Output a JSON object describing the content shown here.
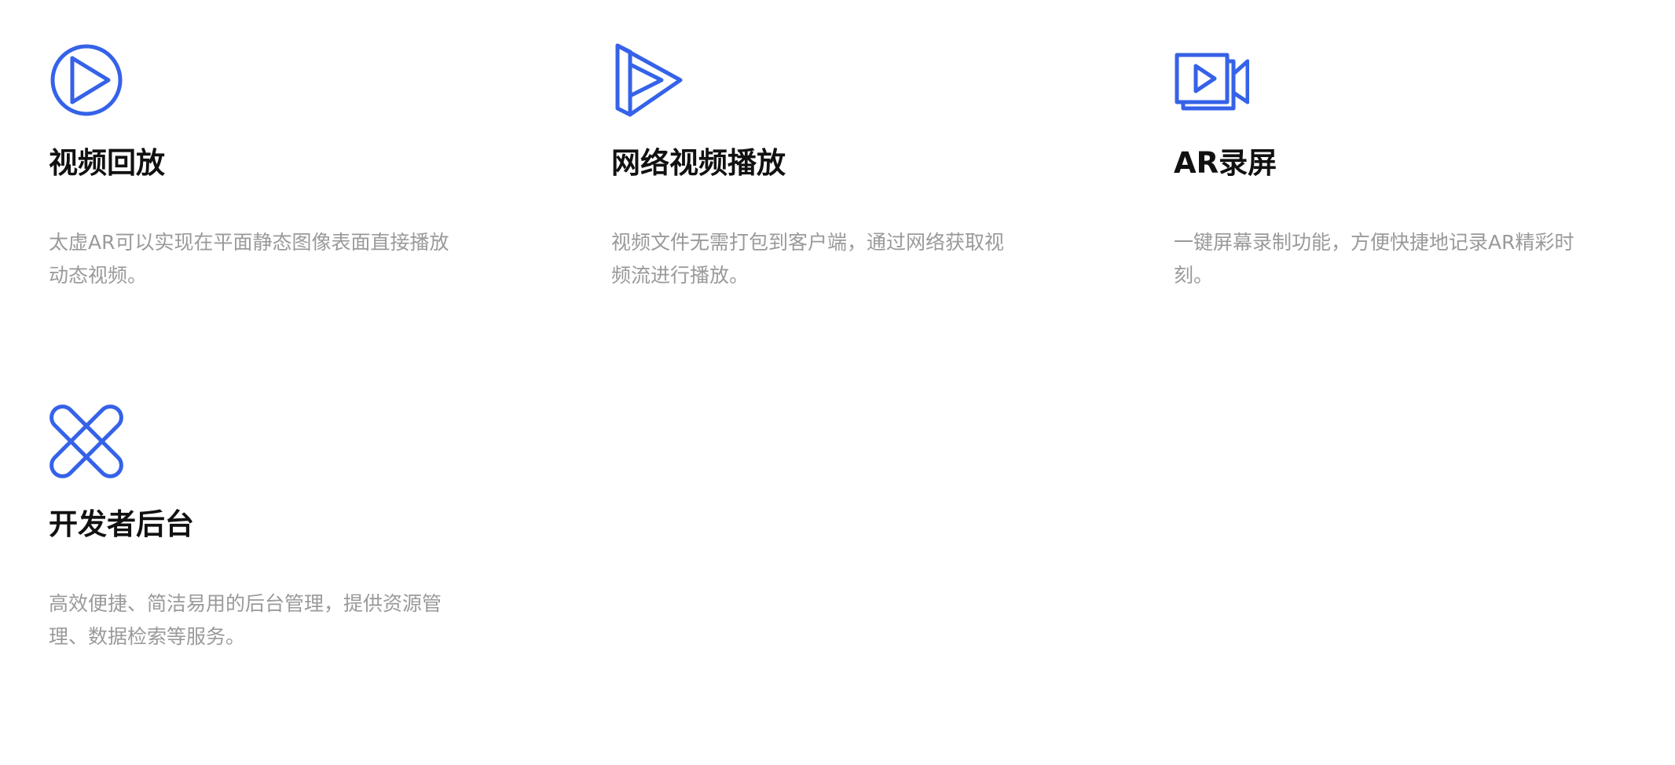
{
  "accent_color": "#3562e8",
  "features": [
    {
      "icon": "play-circle-icon",
      "title": "视频回放",
      "description": "太虚AR可以实现在平面静态图像表面直接播放动态视频。"
    },
    {
      "icon": "network-play-icon",
      "title": "网络视频播放",
      "description": "视频文件无需打包到客户端，通过网络获取视频流进行播放。"
    },
    {
      "icon": "video-camera-icon",
      "title": "AR录屏",
      "description": "一键屏幕录制功能，方便快捷地记录AR精彩时刻。"
    },
    {
      "icon": "developer-backend-icon",
      "title": "开发者后台",
      "description": "高效便捷、简洁易用的后台管理，提供资源管理、数据检索等服务。"
    }
  ]
}
